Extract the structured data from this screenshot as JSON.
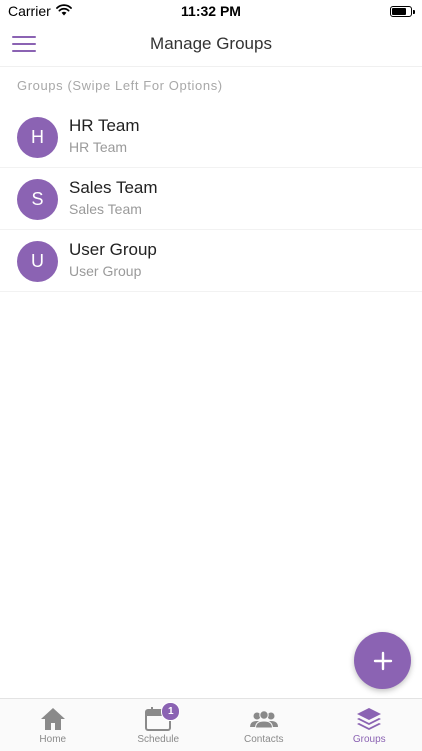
{
  "status_bar": {
    "carrier": "Carrier",
    "time": "11:32 PM"
  },
  "nav": {
    "title": "Manage Groups"
  },
  "section_header": "Groups (Swipe Left For Options)",
  "groups": [
    {
      "initial": "H",
      "name": "HR Team",
      "subtitle": "HR Team"
    },
    {
      "initial": "S",
      "name": "Sales Team",
      "subtitle": "Sales Team"
    },
    {
      "initial": "U",
      "name": "User Group",
      "subtitle": "User Group"
    }
  ],
  "tabs": [
    {
      "label": "Home",
      "icon": "home-icon",
      "active": false
    },
    {
      "label": "Schedule",
      "icon": "calendar-icon",
      "active": false,
      "badge": "1"
    },
    {
      "label": "Contacts",
      "icon": "contacts-icon",
      "active": false
    },
    {
      "label": "Groups",
      "icon": "layers-icon",
      "active": true
    }
  ],
  "colors": {
    "accent": "#8b63b3",
    "inactive": "#8a8a8a"
  }
}
